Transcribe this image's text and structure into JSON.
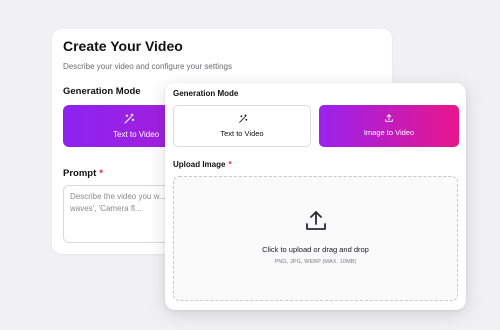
{
  "back": {
    "title": "Create Your Video",
    "subtitle": "Describe your video and configure your settings",
    "mode_label": "Generation Mode",
    "mode_button_label": "Text to Video",
    "prompt_label": "Prompt",
    "prompt_required": "*",
    "prompt_placeholder": "Describe the video you w... gentle waves', 'Camera fl..."
  },
  "front": {
    "mode_label": "Generation Mode",
    "options": [
      {
        "label": "Text to Video",
        "icon": "magic-wand-icon",
        "selected": false
      },
      {
        "label": "Image to Video",
        "icon": "upload-icon",
        "selected": true
      }
    ],
    "upload_label": "Upload Image",
    "upload_required": "*",
    "dropzone": {
      "title": "Click to upload or drag and drop",
      "subtitle": "PNG, JPG, WEBP (MAX. 10MB)",
      "icon": "upload-icon"
    }
  },
  "colors": {
    "background": "#f1f1f3",
    "gradient_start": "#9a22ee",
    "gradient_end": "#e8168b",
    "required": "#e5233a"
  }
}
